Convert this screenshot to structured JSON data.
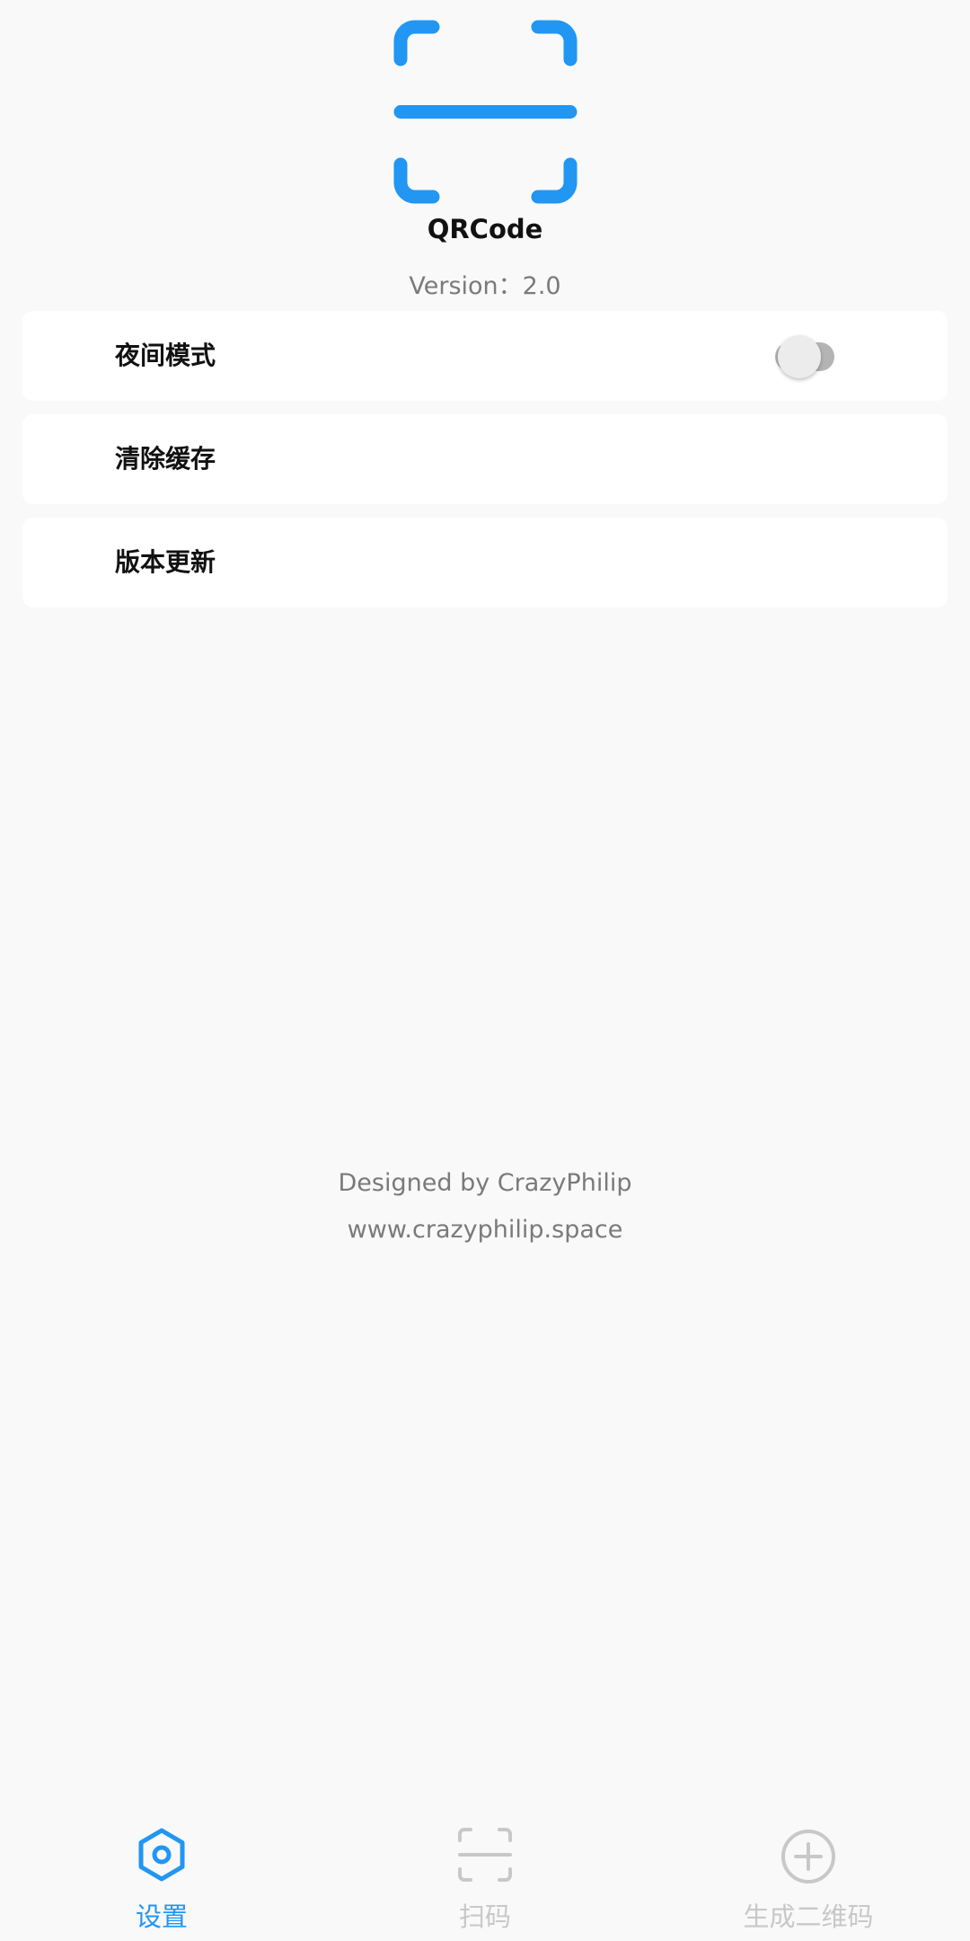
{
  "header": {
    "app_name": "QRCode",
    "version": "Version：2.0"
  },
  "settings": {
    "items": [
      {
        "label": "夜间模式",
        "toggle_on": false
      },
      {
        "label": "清除缓存"
      },
      {
        "label": "版本更新"
      }
    ]
  },
  "credits": {
    "designer": "Designed by CrazyPhilip",
    "website": "www.crazyphilip.space"
  },
  "bottom_nav": {
    "items": [
      {
        "label": "设置",
        "icon": "settings-hexagon-icon",
        "active": true
      },
      {
        "label": "扫码",
        "icon": "scan-icon",
        "active": false
      },
      {
        "label": "生成二维码",
        "icon": "plus-circle-icon",
        "active": false
      }
    ]
  },
  "colors": {
    "accent": "#2196f3",
    "inactive": "#c8c8c8",
    "text_secondary": "#7a7a7a",
    "background": "#f9f9f9",
    "card": "#ffffff"
  }
}
